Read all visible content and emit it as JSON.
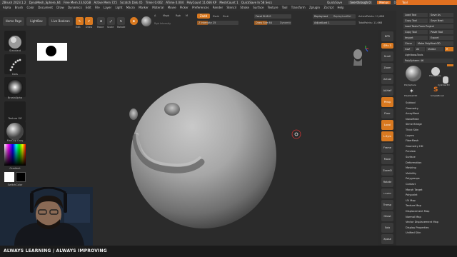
{
  "titlebar": {
    "items": [
      "ZBrush 2023.1.2",
      "DynaMesh_Sphere_64",
      "Free Mem 23.62GB",
      "Active Mem 725",
      "Scratch Disk 45",
      "Timer 0.002",
      "ATime 0.004",
      "PolyCount 11.666 KP",
      "MeshCount 1",
      "QuickSave In 58 Secs"
    ],
    "right_items": [
      "QuickSave",
      "See-through 0",
      "Menus",
      "DefaultZScript"
    ]
  },
  "menubar": {
    "items": [
      "Alpha",
      "Brush",
      "Color",
      "Document",
      "Draw",
      "Dynamics",
      "Edit",
      "File",
      "Layer",
      "Light",
      "Macro",
      "Marker",
      "Material",
      "Movie",
      "Picker",
      "Preferences",
      "Render",
      "Stencil",
      "Stroke",
      "Surface",
      "Texture",
      "Tool",
      "Transform",
      "Zplugin",
      "Zscript",
      "Help"
    ]
  },
  "shelf": {
    "home_page": "Home Page",
    "lightbox": "LightBox",
    "live_boolean": "Live Boolean",
    "tools": [
      {
        "label": "Edit",
        "active": true
      },
      {
        "label": "Draw",
        "active": true
      },
      {
        "label": "Move",
        "active": false
      },
      {
        "label": "Scale",
        "active": false
      },
      {
        "label": "Rotate",
        "active": false
      }
    ],
    "mrgb": "Mrgb",
    "rgb": "Rgb",
    "m": "M",
    "zadd": "Zadd",
    "zsub": "Zsub",
    "zcut": "Zcut",
    "rgb_intensity": "Rgb Intensity",
    "z_intensity": "Z Intensity 25",
    "focal_shift": "Focal Shift 0",
    "draw_size": "Draw Size 64",
    "dynamic": "Dynamic",
    "replay_last": "ReplayLast",
    "replay_last_rel": "ReplayLastRel",
    "adjust_last": "AdjustLast 1",
    "active_points": "ActivePoints: 11,668",
    "total_points": "TotalPoints: 11,668"
  },
  "leftbar": {
    "brush": "Standard",
    "stroke": "Dots",
    "alpha": "BrushAlpha",
    "texture": "Texture Off",
    "material": "MatCap Gray",
    "gradient": "Gradient",
    "switch_color": "SwitchColor",
    "alternate": "Alternate"
  },
  "rightbar": {
    "items": [
      "BPR",
      "SPix 3",
      "Scroll",
      "Zoom",
      "Actual",
      "AAHalf",
      "Persp",
      "Floor",
      "Local",
      "L.Sym",
      "Frame",
      "Move",
      "ZoomD",
      "Rotate",
      "LineFill PolyF",
      "Transp",
      "Ghost",
      "Solo",
      "Xpose"
    ]
  },
  "tool_palette": {
    "title": "Tool",
    "buttons": [
      [
        "Load Tool",
        "Save As"
      ],
      [
        "Copy Tool",
        "Save Next"
      ],
      [
        "Load Tools From Project",
        ""
      ],
      [
        "Copy Tool",
        "Paste Tool"
      ],
      [
        "Import",
        "Export"
      ],
      [
        "Clone",
        "Make PolyMesh3D"
      ],
      [
        "GoZ",
        "All",
        "Visible",
        "R"
      ]
    ],
    "lightbox_tools": "Lightbox▸Tools",
    "current_tool": "PolySphere: 46",
    "thumbs": [
      "PolySphere",
      "PolySphere",
      "Cylinder3D",
      "PolyMesh3D",
      "SimpleBrush"
    ],
    "subpalettes": [
      "Subtool",
      "Geometry",
      "ArrayMesh",
      "NanoMesh",
      "Slime Bridge",
      "Thick Skin",
      "Layers",
      "FiberMesh",
      "Geometry HD",
      "Preview",
      "Surface",
      "Deformation",
      "Masking",
      "Visibility",
      "Polygroups",
      "Contact",
      "Morph Target",
      "Polypaint",
      "UV Map",
      "Texture Map",
      "Displacement Map",
      "Normal Map",
      "Vector Displacement Map",
      "Display Properties",
      "Unified Skin"
    ]
  },
  "overlay": {
    "tagline": "ALWAYS LEARNING  /  ALWAYS IMPROVING"
  },
  "colors": {
    "accent": "#d97920",
    "background": "#262626",
    "panel": "#2f2f2f"
  }
}
